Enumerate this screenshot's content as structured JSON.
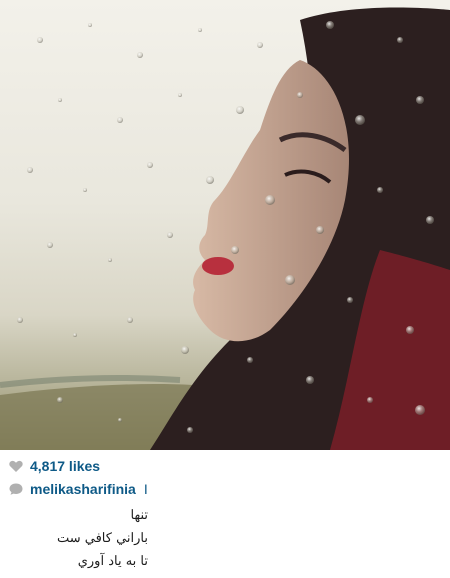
{
  "post": {
    "image": {
      "subject": "photo-rain-window"
    },
    "likes": {
      "text": "4,817 likes",
      "icon": "heart-icon"
    },
    "author": {
      "username": "melikasharifinia",
      "icon": "comment-icon",
      "trail": "I"
    },
    "caption_lines": [
      "تنها",
      "باراني كافي ست",
      "تا به ياد آوري"
    ]
  },
  "colors": {
    "link": "#0e5a87",
    "text": "#1b1b1b",
    "lips": "#b8303e"
  }
}
